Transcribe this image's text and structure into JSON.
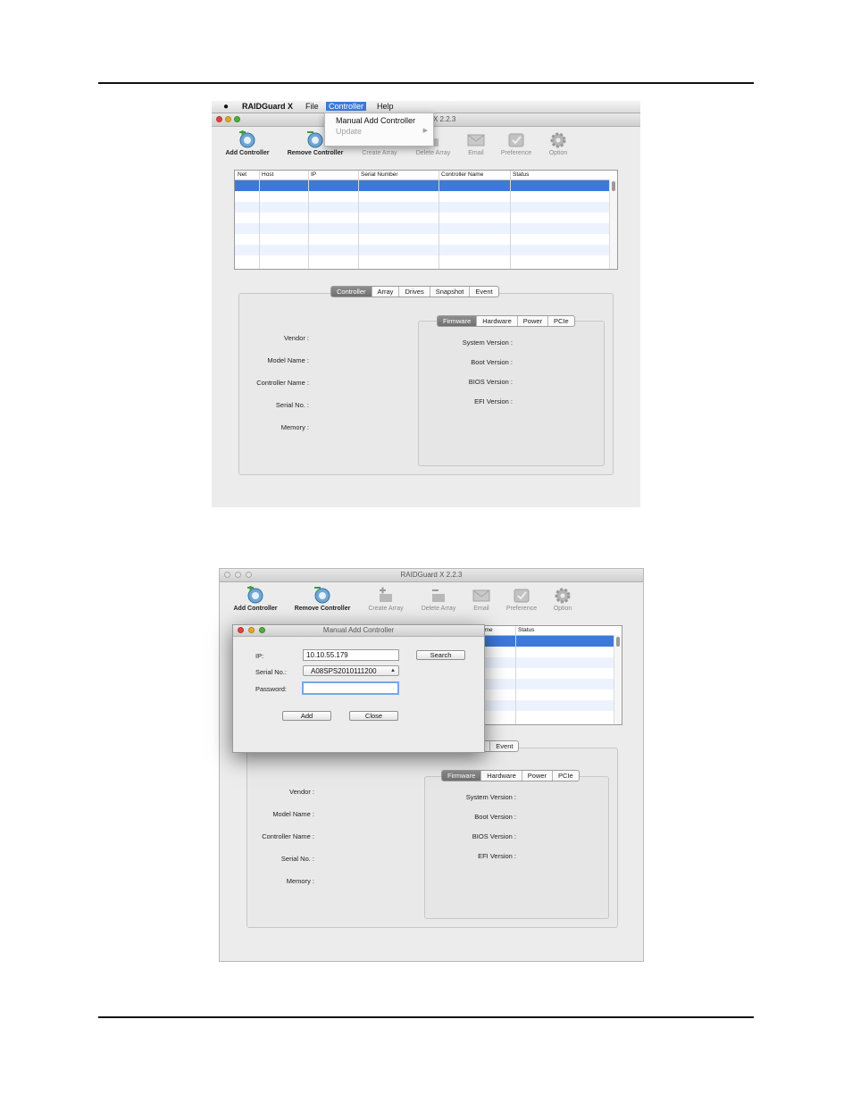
{
  "app": {
    "name": "RAIDGuard X",
    "version_title": "RAIDGuard X 2.2.3",
    "version_fragment": "X 2.2.3",
    "menu": [
      "File",
      "Controller",
      "Help"
    ],
    "controller_menu": {
      "manual_add": "Manual Add Controller",
      "update": "Update"
    }
  },
  "toolbar": {
    "add_controller": "Add Controller",
    "remove_controller": "Remove Controller",
    "create_array": "Create Array",
    "delete_array": "Delete Array",
    "email": "Email",
    "preference": "Preference",
    "option": "Option",
    "remove_controller_partial": "Remove Controller",
    "create_array_partial": "Create Array",
    "delete_array_partial": "Delete Array"
  },
  "table": {
    "columns": [
      "Net",
      "Host",
      "IP",
      "Serial Number",
      "Controller Name",
      "Status"
    ],
    "partial_columns": [
      "ame",
      "Status"
    ]
  },
  "main_tabs": [
    "Controller",
    "Array",
    "Drives",
    "Snapshot",
    "Event"
  ],
  "main_tabs_partial": [
    "ot",
    "Event"
  ],
  "controller_fields": [
    "Vendor :",
    "Model Name :",
    "Controller Name :",
    "Serial No. :",
    "Memory :"
  ],
  "sub_tabs": [
    "Firmware",
    "Hardware",
    "Power",
    "PCIe"
  ],
  "firmware_fields": [
    "System Version :",
    "Boot Version :",
    "BIOS Version :",
    "EFI Version :"
  ],
  "dialog": {
    "title": "Manual Add Controller",
    "ip_label": "IP:",
    "ip_value": "10.10.55.179",
    "serial_label": "Serial No.:",
    "serial_value": "A08SPS2010111200",
    "password_label": "Password:",
    "password_value": "",
    "search_button": "Search",
    "add_button": "Add",
    "close_button": "Close"
  },
  "colors": {
    "selection": "#3d79d9",
    "window_bg": "#ececec"
  }
}
